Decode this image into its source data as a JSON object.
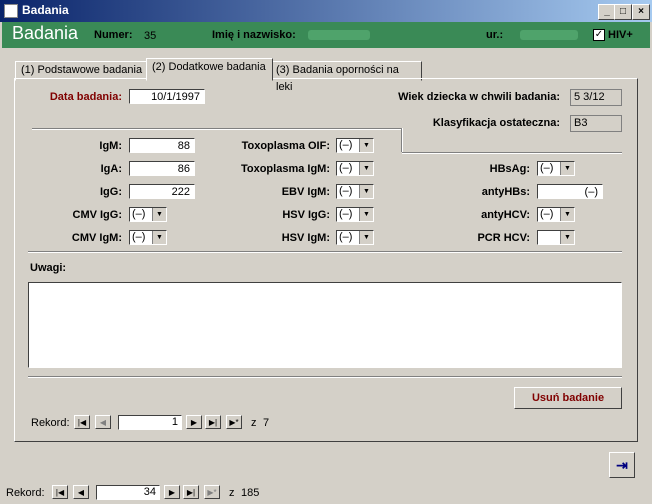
{
  "window": {
    "title": "Badania"
  },
  "header": {
    "title": "Badania",
    "numer_label": "Numer:",
    "numer_value": "35",
    "name_label": "Imię i nazwisko:",
    "ur_label": "ur.:",
    "hiv_label": "HIV+",
    "hiv_checked": "✓"
  },
  "tabs": [
    {
      "label": "(1) Podstawowe badania"
    },
    {
      "label": "(2) Dodatkowe badania"
    },
    {
      "label": "(3) Badania oporności na leki"
    }
  ],
  "form": {
    "data_badania_label": "Data badania:",
    "data_badania_value": "10/1/1997",
    "wiek_label": "Wiek dziecka w chwili badania:",
    "wiek_value": "5 3/12",
    "klasyfikacja_label": "Klasyfikacja ostateczna:",
    "klasyfikacja_value": "B3",
    "igm_label": "IgM:",
    "igm_value": "88",
    "iga_label": "IgA:",
    "iga_value": "86",
    "igg_label": "IgG:",
    "igg_value": "222",
    "cmv_igg_label": "CMV IgG:",
    "cmv_igg_value": "(–)",
    "cmv_igm_label": "CMV IgM:",
    "cmv_igm_value": "(–)",
    "toxo_oif_label": "Toxoplasma OIF:",
    "toxo_oif_value": "(–)",
    "toxo_igm_label": "Toxoplasma IgM:",
    "toxo_igm_value": "(–)",
    "ebv_igm_label": "EBV IgM:",
    "ebv_igm_value": "(–)",
    "hsv_igg_label": "HSV IgG:",
    "hsv_igg_value": "(–)",
    "hsv_igm_label": "HSV IgM:",
    "hsv_igm_value": "(–)",
    "hbsag_label": "HBsAg:",
    "hbsag_value": "(–)",
    "antyhbs_label": "antyHBs:",
    "antyhbs_value": "(–)",
    "antyhcv_label": "antyHCV:",
    "antyhcv_value": "(–)",
    "pcr_hcv_label": "PCR HCV:",
    "pcr_hcv_value": "",
    "uwagi_label": "Uwagi:",
    "uwagi_value": "",
    "usun_label": "Usuń badanie"
  },
  "inner_nav": {
    "label": "Rekord:",
    "current": "1",
    "of_label": "z",
    "total": "7"
  },
  "outer_nav": {
    "label": "Rekord:",
    "current": "34",
    "of_label": "z",
    "total": "185"
  },
  "colors": {
    "title_bar": "#0a246a",
    "header_green": "#3a8a56",
    "data_label_red": "#800000"
  }
}
